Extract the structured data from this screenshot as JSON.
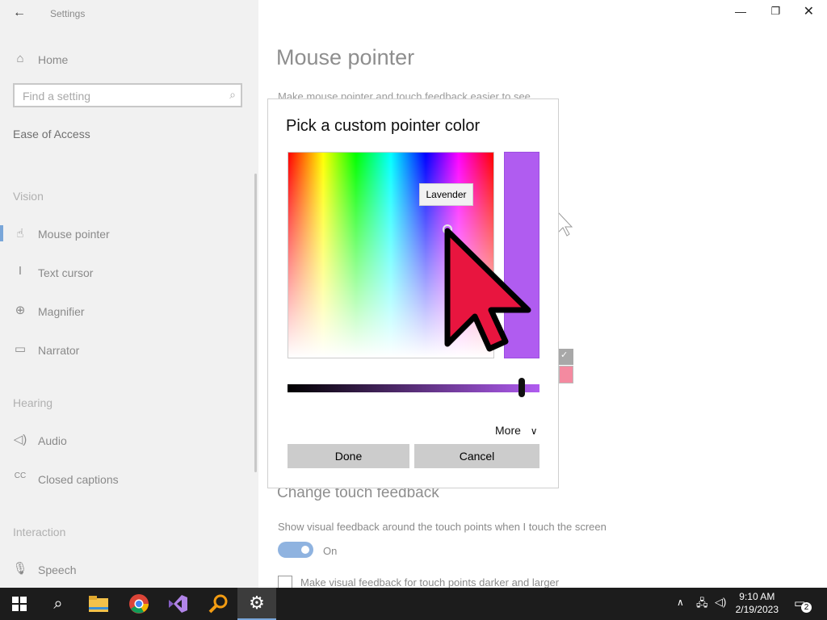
{
  "window": {
    "title": "Settings",
    "back_icon": "arrow-left-icon",
    "minimize_icon": "minimize-icon",
    "restore_icon": "restore-icon",
    "close_icon": "close-icon"
  },
  "sidebar": {
    "home_label": "Home",
    "search_placeholder": "Find a setting",
    "category": "Ease of Access",
    "sections": [
      {
        "heading": "Vision",
        "items": [
          {
            "label": "Mouse pointer",
            "icon": "mouse-pointer-icon",
            "selected": true
          },
          {
            "label": "Text cursor",
            "icon": "text-cursor-icon"
          },
          {
            "label": "Magnifier",
            "icon": "magnifier-icon"
          },
          {
            "label": "Narrator",
            "icon": "narrator-icon"
          }
        ]
      },
      {
        "heading": "Hearing",
        "items": [
          {
            "label": "Audio",
            "icon": "speaker-icon"
          },
          {
            "label": "Closed captions",
            "icon": "closed-captions-icon"
          }
        ]
      },
      {
        "heading": "Interaction",
        "items": [
          {
            "label": "Speech",
            "icon": "microphone-icon"
          }
        ]
      }
    ]
  },
  "main": {
    "page_title": "Mouse pointer",
    "subtitle": "Make mouse pointer and touch feedback easier to see",
    "touch_heading": "Change touch feedback",
    "touch_desc": "Show visual feedback around the touch points when I touch the screen",
    "toggle_state": "On",
    "checkbox_label": "Make visual feedback for touch points darker and larger"
  },
  "dialog": {
    "title": "Pick a custom pointer color",
    "tooltip": "Lavender",
    "selected_color": "#b05cf0",
    "brightness_value": 0.93,
    "more_label": "More",
    "done_label": "Done",
    "cancel_label": "Cancel"
  },
  "taskbar": {
    "apps": [
      {
        "name": "start-icon"
      },
      {
        "name": "search-icon"
      },
      {
        "name": "file-explorer-icon"
      },
      {
        "name": "chrome-icon"
      },
      {
        "name": "visual-studio-icon"
      },
      {
        "name": "magnifier-app-icon"
      },
      {
        "name": "settings-gear-icon",
        "active": true
      }
    ],
    "time": "9:10 AM",
    "date": "2/19/2023",
    "notification_count": "2"
  },
  "colors": {
    "accent": "#79a6d9",
    "pointer_overlay": "#e8153f",
    "taskbar": "#1c1c1c"
  }
}
